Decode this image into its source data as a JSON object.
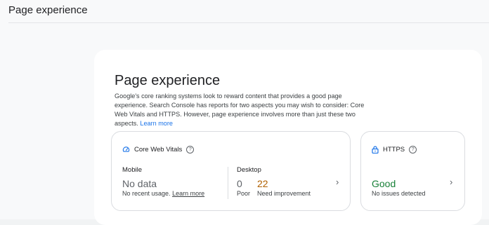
{
  "header": {
    "title": "Page experience"
  },
  "card": {
    "title": "Page experience",
    "description": "Google's core ranking systems look to reward content that provides a good page experience. Search Console has reports for two aspects you may wish to consider: Core Web Vitals and HTTPS. However, page experience involves more than just these two aspects.",
    "learn_more": "Learn more"
  },
  "core_web_vitals": {
    "title": "Core Web Vitals",
    "help_icon": "?",
    "mobile": {
      "label": "Mobile",
      "status": "No data",
      "note": "No recent usage.",
      "learn_more": "Learn more"
    },
    "desktop": {
      "label": "Desktop",
      "poor_count": "0",
      "poor_label": "Poor",
      "ni_count": "22",
      "ni_label": "Need improvement"
    }
  },
  "https": {
    "title": "HTTPS",
    "help_icon": "?",
    "status": "Good",
    "note": "No issues detected"
  },
  "colors": {
    "link": "#1a73e8",
    "good": "#188038",
    "need_improvement": "#b06000",
    "icon_blue": "#1a73e8"
  },
  "icons": {
    "cwv": "gauge-icon",
    "https": "lock-icon",
    "help": "help-icon",
    "chevron": "chevron-right-icon"
  }
}
